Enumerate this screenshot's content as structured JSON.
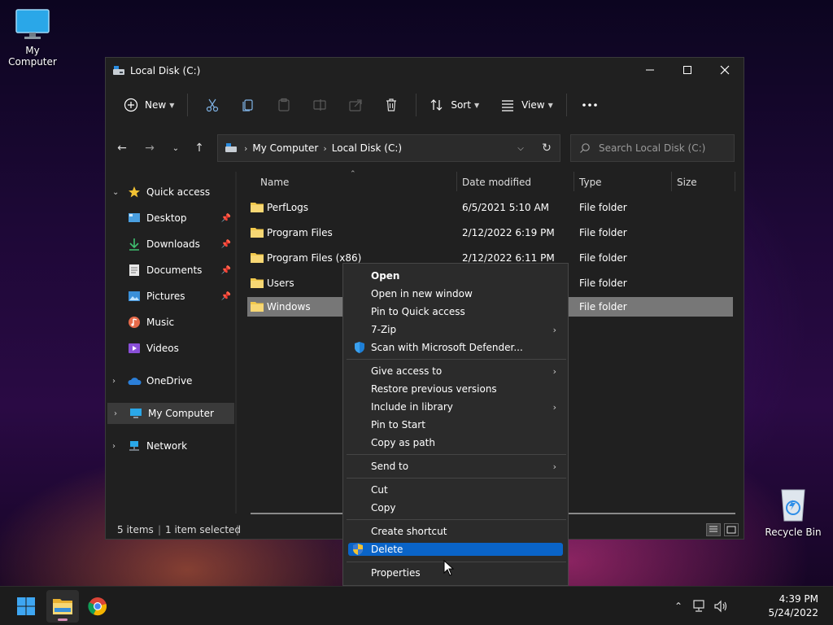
{
  "desktop": {
    "icons": [
      {
        "label": "My Computer"
      },
      {
        "label": "Recycle Bin"
      }
    ]
  },
  "window": {
    "title": "Local Disk (C:)",
    "toolbar": {
      "new_label": "New",
      "sort_label": "Sort",
      "view_label": "View"
    },
    "address": {
      "crumbs": [
        "My Computer",
        "Local Disk (C:)"
      ]
    },
    "search": {
      "placeholder": "Search Local Disk (C:)"
    },
    "nav_pane": {
      "quick_access": "Quick access",
      "items": [
        {
          "label": "Desktop"
        },
        {
          "label": "Downloads"
        },
        {
          "label": "Documents"
        },
        {
          "label": "Pictures"
        },
        {
          "label": "Music"
        },
        {
          "label": "Videos"
        }
      ],
      "onedrive": "OneDrive",
      "my_computer": "My Computer",
      "network": "Network"
    },
    "columns": [
      "Name",
      "Date modified",
      "Type",
      "Size"
    ],
    "files": [
      {
        "name": "PerfLogs",
        "date": "6/5/2021 5:10 AM",
        "type": "File folder"
      },
      {
        "name": "Program Files",
        "date": "2/12/2022 6:19 PM",
        "type": "File folder"
      },
      {
        "name": "Program Files (x86)",
        "date": "2/12/2022 6:11 PM",
        "type": "File folder"
      },
      {
        "name": "Users",
        "date": "",
        "type": "File folder"
      },
      {
        "name": "Windows",
        "date": "",
        "type": "File folder"
      }
    ],
    "status": {
      "items": "5 items",
      "selected": "1 item selected"
    }
  },
  "context_menu": {
    "items": [
      {
        "label": "Open"
      },
      {
        "label": "Open in new window"
      },
      {
        "label": "Pin to Quick access"
      },
      {
        "label": "7-Zip"
      },
      {
        "label": "Scan with Microsoft Defender..."
      },
      {
        "label": "Give access to"
      },
      {
        "label": "Restore previous versions"
      },
      {
        "label": "Include in library"
      },
      {
        "label": "Pin to Start"
      },
      {
        "label": "Copy as path"
      },
      {
        "label": "Send to"
      },
      {
        "label": "Cut"
      },
      {
        "label": "Copy"
      },
      {
        "label": "Create shortcut"
      },
      {
        "label": "Delete"
      },
      {
        "label": "Properties"
      }
    ]
  },
  "taskbar": {
    "time": "4:39 PM",
    "date": "5/24/2022"
  },
  "colors": {
    "accent": "#0a64c8",
    "selection": "#777777",
    "folder": "#f2c94c"
  }
}
